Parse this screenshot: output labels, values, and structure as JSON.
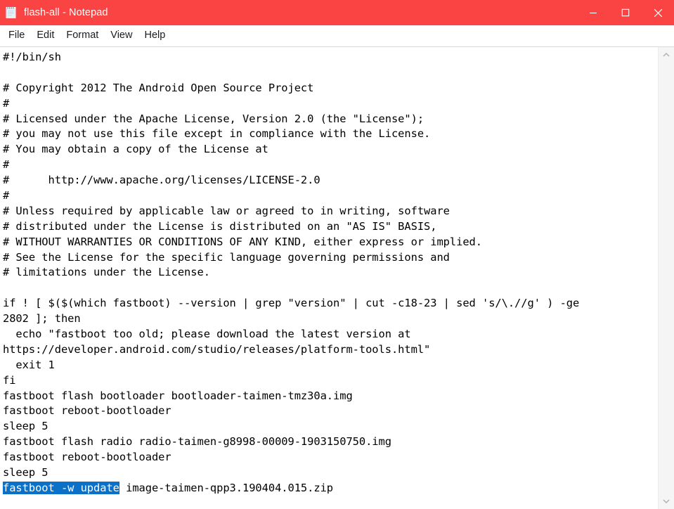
{
  "window": {
    "title": "flash-all - Notepad",
    "icon": "notepad-icon",
    "titlebar_color": "#fa4444",
    "controls": {
      "minimize_label": "Minimize",
      "maximize_label": "Maximize",
      "close_label": "Close"
    }
  },
  "menubar": {
    "items": [
      {
        "label": "File"
      },
      {
        "label": "Edit"
      },
      {
        "label": "Format"
      },
      {
        "label": "View"
      },
      {
        "label": "Help"
      }
    ]
  },
  "editor": {
    "selection_color": "#0a70c8",
    "selected_text": "fastboot -w update",
    "lines": [
      "#!/bin/sh",
      "",
      "# Copyright 2012 The Android Open Source Project",
      "#",
      "# Licensed under the Apache License, Version 2.0 (the \"License\");",
      "# you may not use this file except in compliance with the License.",
      "# You may obtain a copy of the License at",
      "#",
      "#      http://www.apache.org/licenses/LICENSE-2.0",
      "#",
      "# Unless required by applicable law or agreed to in writing, software",
      "# distributed under the License is distributed on an \"AS IS\" BASIS,",
      "# WITHOUT WARRANTIES OR CONDITIONS OF ANY KIND, either express or implied.",
      "# See the License for the specific language governing permissions and",
      "# limitations under the License.",
      "",
      "if ! [ $($(which fastboot) --version | grep \"version\" | cut -c18-23 | sed 's/\\.//g' ) -ge",
      "2802 ]; then",
      "  echo \"fastboot too old; please download the latest version at",
      "https://developer.android.com/studio/releases/platform-tools.html\"",
      "  exit 1",
      "fi",
      "fastboot flash bootloader bootloader-taimen-tmz30a.img",
      "fastboot reboot-bootloader",
      "sleep 5",
      "fastboot flash radio radio-taimen-g8998-00009-1903150750.img",
      "fastboot reboot-bootloader",
      "sleep 5"
    ],
    "last_line": {
      "selected": "fastboot -w update",
      "rest": " image-taimen-qpp3.190404.015.zip"
    }
  },
  "scrollbar": {
    "up_arrow": "chevron-up-icon",
    "down_arrow": "chevron-down-icon"
  }
}
